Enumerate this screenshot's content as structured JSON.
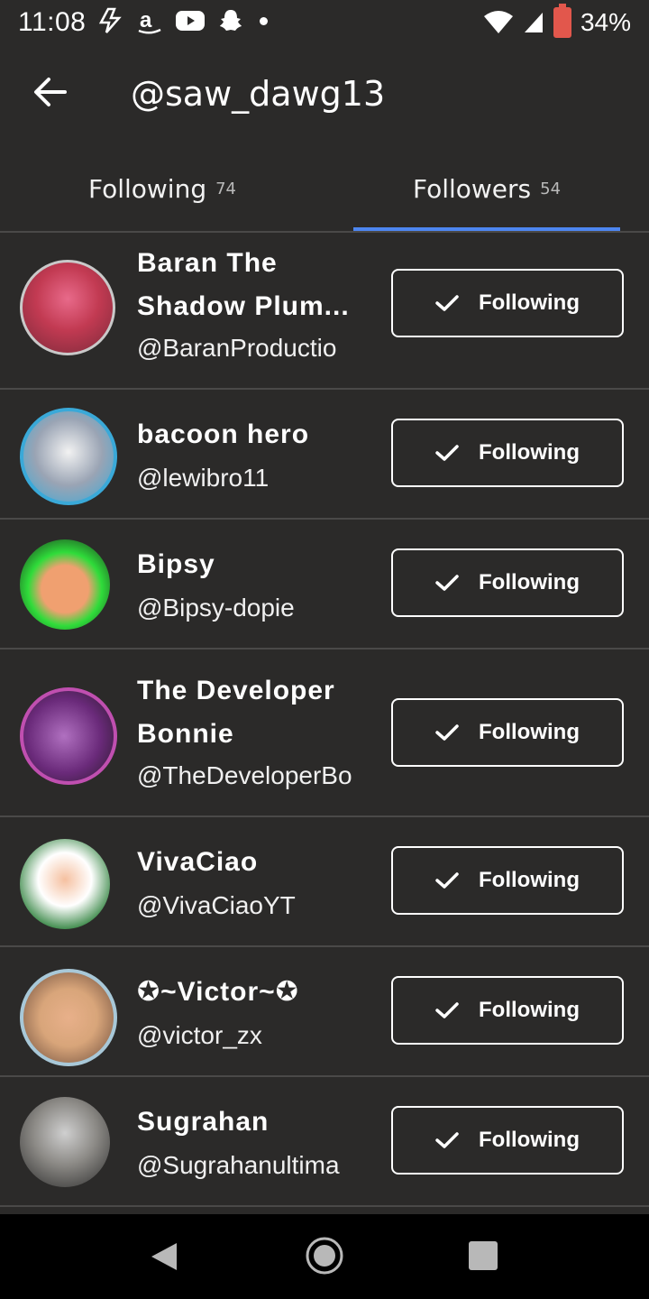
{
  "status_bar": {
    "time": "11:08",
    "battery_percent": "34%",
    "icons_left": [
      "flash-icon",
      "amazon-icon",
      "youtube-icon",
      "snapchat-icon",
      "notification-dot"
    ],
    "icons_right": [
      "wifi-icon",
      "cellular-icon",
      "battery-icon"
    ]
  },
  "header": {
    "title": "@saw_dawg13"
  },
  "tabs": [
    {
      "label": "Following",
      "count": "74"
    },
    {
      "label": "Followers",
      "count": "54",
      "active": true
    }
  ],
  "users": [
    {
      "name": "Baran The Shadow Plum...",
      "name_lines": [
        "Baran The",
        "Shadow Plum..."
      ],
      "handle": "@BaranProductio",
      "button": "Following",
      "avatar_color": "#c23a52"
    },
    {
      "name": "bacoon hero",
      "name_lines": [
        "bacoon hero"
      ],
      "handle": "@lewibro11",
      "button": "Following",
      "avatar_color": "#3aa9d8"
    },
    {
      "name": "Bipsy",
      "name_lines": [
        "Bipsy"
      ],
      "handle": "@Bipsy-dopie",
      "button": "Following",
      "avatar_color": "#2fdc3a"
    },
    {
      "name": "The Developer Bonnie",
      "name_lines": [
        "The Developer",
        "Bonnie"
      ],
      "handle": "@TheDeveloperBo",
      "button": "Following",
      "avatar_color": "#8a3a9c"
    },
    {
      "name": "VivaCiao",
      "name_lines": [
        "VivaCiao"
      ],
      "handle": "@VivaCiaoYT",
      "button": "Following",
      "avatar_color": "#ffffff"
    },
    {
      "name": "✪~Victor~✪",
      "name_lines": [
        "✪~Victor~✪"
      ],
      "handle": "@victor_zx",
      "button": "Following",
      "avatar_color": "#d8a57a"
    },
    {
      "name": "Sugrahan",
      "name_lines": [
        "Sugrahan"
      ],
      "handle": "@Sugrahanultima",
      "button": "Following",
      "avatar_color": "#8c8a86"
    }
  ],
  "colors": {
    "background": "#2b2a29",
    "accent": "#4d86f0",
    "divider": "#4a4948"
  }
}
